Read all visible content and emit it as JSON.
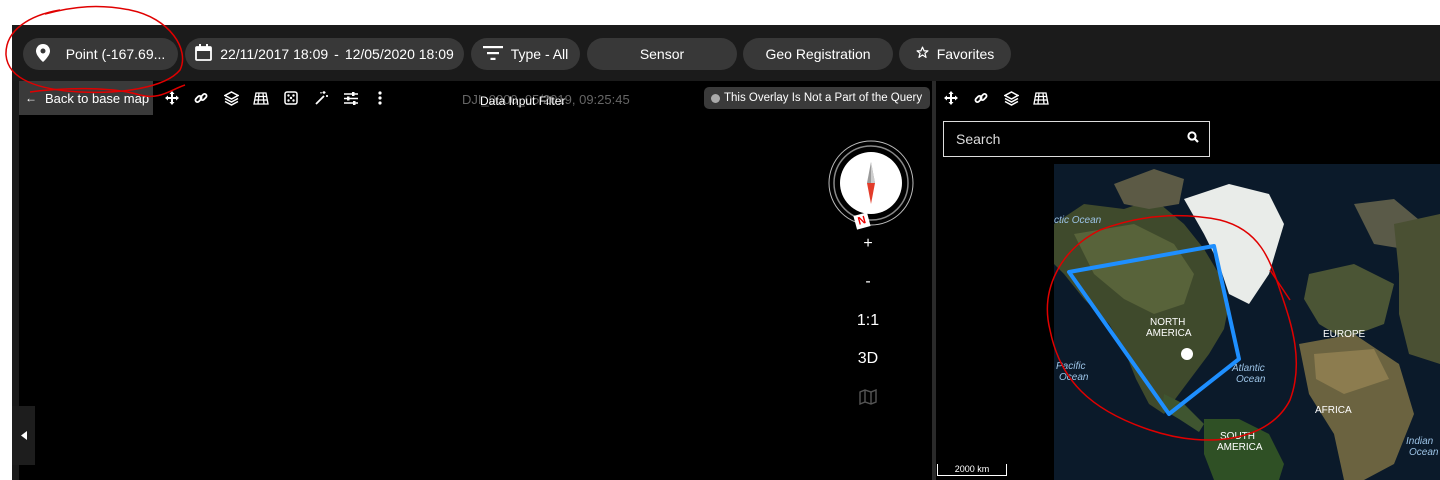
{
  "toolbar": {
    "location_label": "Point (-167.69...",
    "date_from": "22/11/2017 18:09",
    "date_sep": "-",
    "date_to": "12/05/2020 18:09",
    "type_label": "Type - All",
    "sensor_label": "Sensor",
    "georeg_label": "Geo Registration",
    "favorites_label": "Favorites"
  },
  "left_map": {
    "back_label": "Back to base map",
    "title_under": "DJI_0000_05/2019, 09:25:45",
    "title_over": "Data Input Filter",
    "overlay_status": "This Overlay Is Not a Part of the Query",
    "compass_north": "N",
    "zoom_in": "+",
    "zoom_out": "-",
    "ratio": "1:1",
    "mode_3d": "3D"
  },
  "right_map": {
    "search_placeholder": "Search",
    "scale_label": "2000 km",
    "labels": {
      "arctic": "ctic Ocean",
      "na1": "NORTH",
      "na2": "AMERICA",
      "pac1": "Pacific",
      "pac2": "Ocean",
      "atl1": "Atlantic",
      "atl2": "Ocean",
      "europe": "EUROPE",
      "africa": "AFRICA",
      "sa1": "SOUTH",
      "sa2": "AMERICA",
      "ind1": "Indian",
      "ind2": "Ocean"
    }
  },
  "colors": {
    "topbar_bg": "#1b1b1b",
    "pill_bg": "#383838",
    "polygon": "#1e90ff",
    "annotation": "#e00000"
  }
}
